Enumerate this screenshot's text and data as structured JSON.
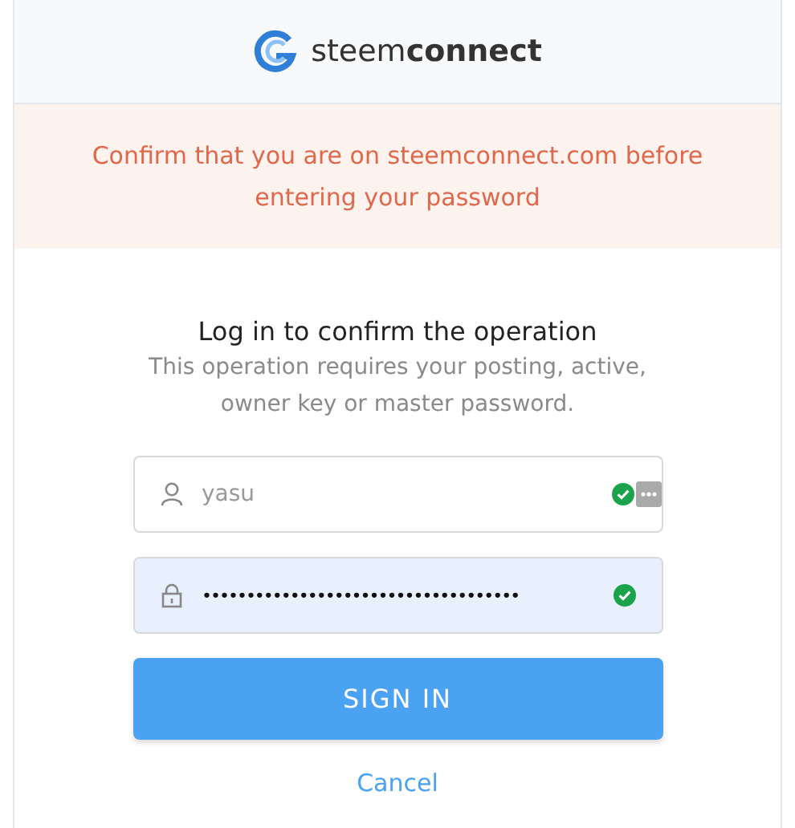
{
  "header": {
    "logo_text": "steem**connect**"
  },
  "warning": {
    "text": "Confirm that you are on steemconnect.com before entering your password"
  },
  "form": {
    "title": "Log in to confirm the operation",
    "subtitle": "This operation requires your posting, active, owner key or master password.",
    "fields": [
      {
        "kind": "username",
        "value": "yasu",
        "valid": true,
        "autofilled": false
      },
      {
        "kind": "password",
        "value": "••••••••••••••••••••••••••••••••••••",
        "valid": true,
        "autofilled": true
      }
    ],
    "submit": "SIGN IN",
    "cancel": "Cancel"
  }
}
